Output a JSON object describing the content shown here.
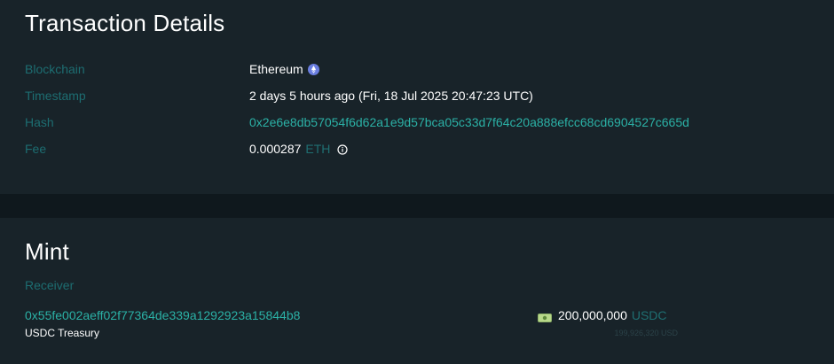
{
  "transaction": {
    "title": "Transaction Details",
    "blockchain_label": "Blockchain",
    "blockchain_value": "Ethereum",
    "timestamp_label": "Timestamp",
    "timestamp_value": "2 days 5 hours ago (Fri, 18 Jul 2025 20:47:23 UTC)",
    "hash_label": "Hash",
    "hash_value": "0x2e6e8db57054f6d62a1e9d57bca05c33d7f64c20a888efcc68cd6904527c665d",
    "fee_label": "Fee",
    "fee_value": "0.000287",
    "fee_unit": "ETH"
  },
  "mint": {
    "title": "Mint",
    "receiver_label": "Receiver",
    "receiver_address": "0x55fe002aeff02f77364de339a1292923a15844b8",
    "receiver_name": "USDC Treasury",
    "amount_value": "200,000,000",
    "amount_unit": "USDC",
    "amount_usd": "199,926,320 USD"
  },
  "icons": {
    "chain": "ethereum-icon",
    "fee_info": "info-icon",
    "amount": "cash-icon"
  },
  "colors": {
    "background": "#182329",
    "band": "#0f181d",
    "label": "#1d6d71",
    "link": "#2bb1a6",
    "text": "#ffffff"
  }
}
